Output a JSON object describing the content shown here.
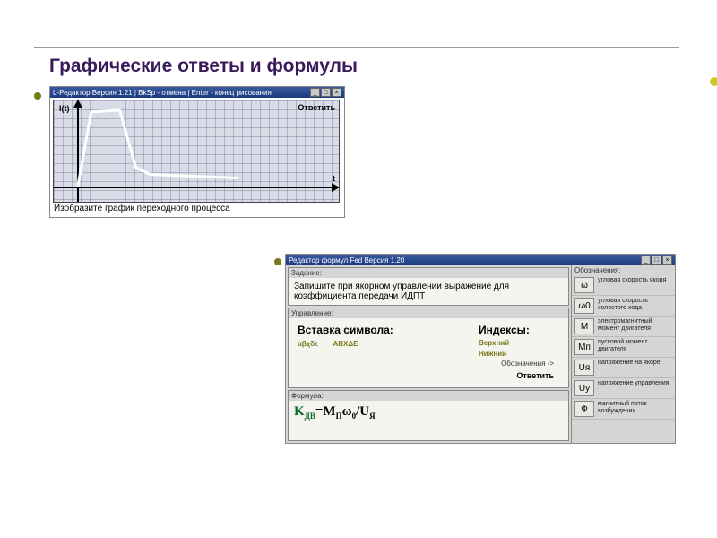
{
  "title": "Графические ответы и формулы",
  "graph_editor": {
    "titlebar": "L-Редактор   Версия 1.21  |  BkSp - отмена  |  Enter - конец рисования",
    "y_label": "I(t)",
    "x_label": "t",
    "answer_label": "Ответить",
    "caption": "Изобразите график переходного процесса"
  },
  "formula_editor": {
    "titlebar": "Редактор формул Fed   Версия 1.20",
    "sections": {
      "task_hdr": "Задание:",
      "task_text": "Запишите при якорном управлении выражение для коэффициента передачи ИДПТ",
      "ctrl_hdr": "Управление:",
      "insert_label": "Вставка символа:",
      "sym_group_greek": "αβχδε",
      "sym_group_latex": "ABXΔE",
      "index_label": "Индексы:",
      "index_top": "Верхний",
      "index_bot": "Нижний",
      "obzn": "Обозначения ->",
      "answer_label": "Ответить",
      "formula_hdr": "Формула:",
      "formula_K": "K",
      "formula_Ksub": "ДВ",
      "formula_eq": "=M",
      "formula_Msub": "П",
      "formula_w": "ω",
      "formula_wsub": "0",
      "formula_slash": "/U",
      "formula_Usub": "Я",
      "legend_hdr": "Обозначения:"
    },
    "legend": [
      {
        "sym": "ω",
        "txt": "угловая скорость якоря"
      },
      {
        "sym": "ω0",
        "txt": "угловая скорость холостого хода"
      },
      {
        "sym": "M",
        "txt": "электромагнитный момент двигателя"
      },
      {
        "sym": "Mп",
        "txt": "пусковой момент двигателя"
      },
      {
        "sym": "Uя",
        "txt": "напряжение на якоре"
      },
      {
        "sym": "Uу",
        "txt": "напряжение управления"
      },
      {
        "sym": "Ф",
        "txt": "магнитный поток возбуждения"
      }
    ]
  },
  "chart_data": {
    "type": "line",
    "title": "",
    "xlabel": "t",
    "ylabel": "I(t)",
    "x": [
      0,
      0.5,
      1.6,
      2.2,
      2.8,
      6.2
    ],
    "y": [
      0,
      8.6,
      8.8,
      2.0,
      1.4,
      0.9
    ],
    "xlim": [
      0,
      10
    ],
    "ylim": [
      0,
      10
    ]
  }
}
